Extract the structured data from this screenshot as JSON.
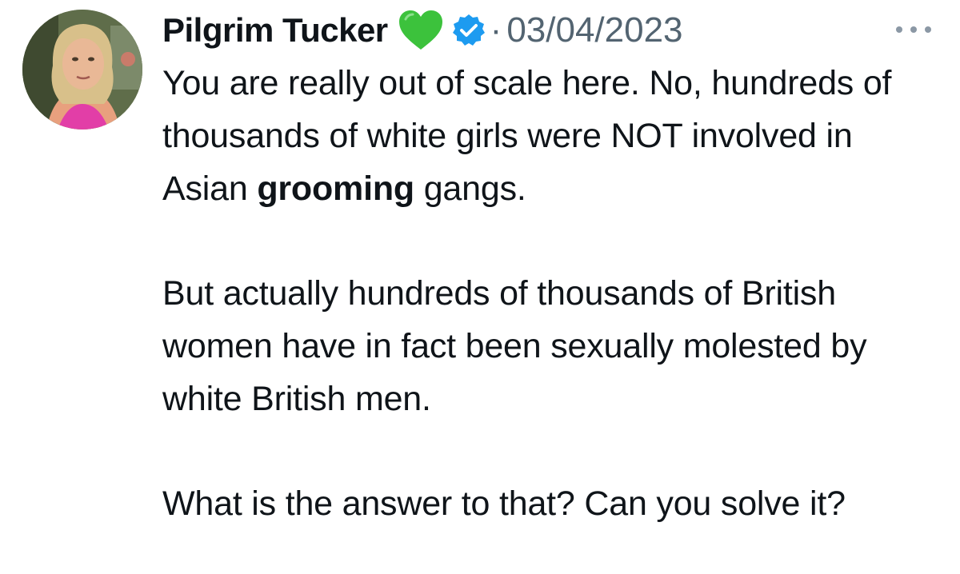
{
  "tweet": {
    "author_name": "Pilgrim Tucker",
    "separator": "·",
    "date": "03/04/2023",
    "icons": {
      "heart": "green-heart-icon",
      "verified": "verified-badge-icon",
      "more": "more-options-icon",
      "avatar": "avatar"
    },
    "colors": {
      "text": "#0f1419",
      "muted": "#536471",
      "verified": "#1d9bf0",
      "heart": "#3cc23c"
    },
    "paragraph1": {
      "before_bold": "You are really out of scale here. No, hundreds of thousands of white girls were NOT involved in Asian ",
      "bold": "grooming",
      "after_bold": " gangs."
    },
    "paragraph2": "But actually hundreds of thousands of British women have in fact been sexually molested by white British men.",
    "paragraph3": "What is the answer to that? Can you solve it?"
  }
}
